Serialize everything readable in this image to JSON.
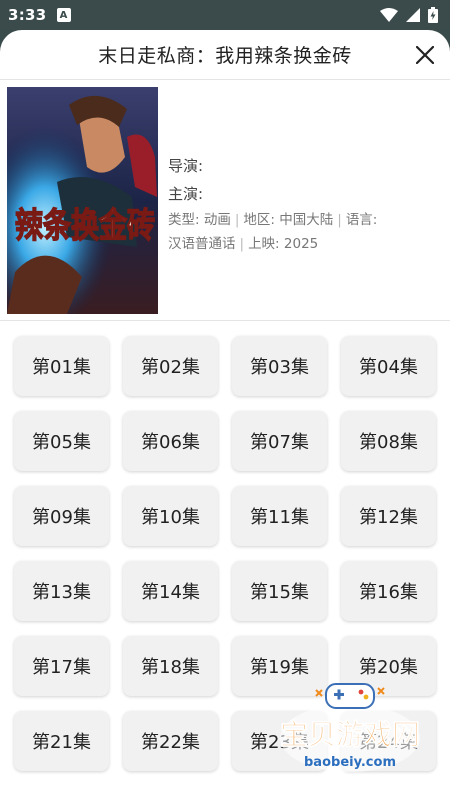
{
  "status_bar": {
    "time": "3:33",
    "badge_letter": "A"
  },
  "header": {
    "title": "末日走私商：我用辣条换金砖"
  },
  "poster": {
    "title_text": "辣条换金砖"
  },
  "details": {
    "director_label": "导演:",
    "cast_label": "主演:",
    "type_label": "类型: 动画",
    "region_label": "地区: 中国大陆",
    "language_label": "语言:",
    "language_value": "汉语普通话",
    "release_label": "上映: 2025"
  },
  "episodes": [
    "第01集",
    "第02集",
    "第03集",
    "第04集",
    "第05集",
    "第06集",
    "第07集",
    "第08集",
    "第09集",
    "第10集",
    "第11集",
    "第12集",
    "第13集",
    "第14集",
    "第15集",
    "第16集",
    "第17集",
    "第18集",
    "第19集",
    "第20集",
    "第21集",
    "第22集",
    "第23集",
    "第24集"
  ],
  "watermark": {
    "brand": "宝贝游戏网",
    "url": "baobeiy.com"
  },
  "colors": {
    "status_bar": "#3b4b4b",
    "sheet_bg": "#ffffff",
    "episode_bg": "#f1f1f1",
    "watermark_orange": "#f08a1c"
  }
}
